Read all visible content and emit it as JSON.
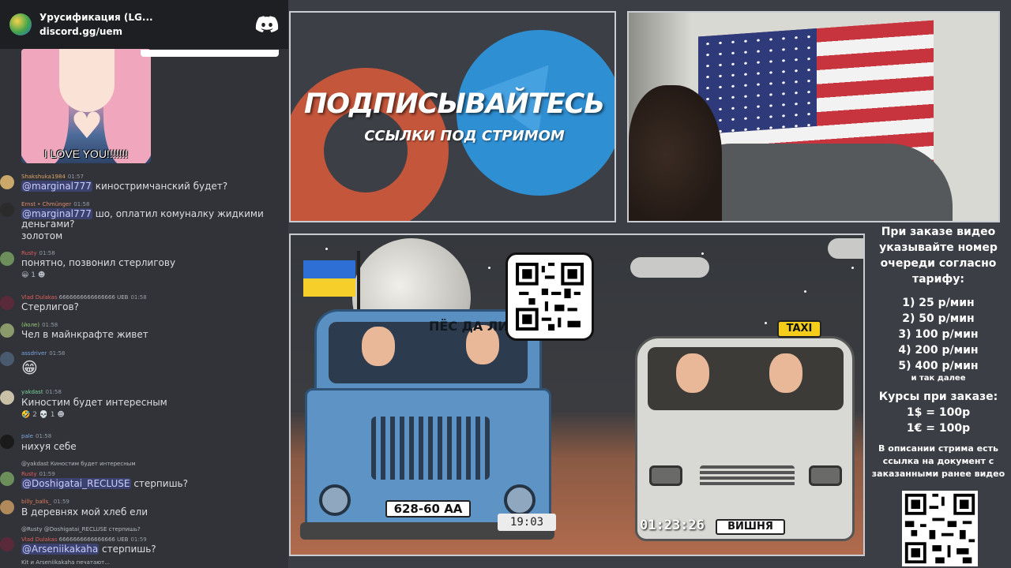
{
  "server": {
    "name": "Урусификация (LG...",
    "invite": "discord.gg/uem"
  },
  "gif": {
    "caption": "I LOVE YOU!!!!!!!"
  },
  "messages": [
    {
      "author": "Shakshuka1984",
      "author_color": "#d9a466",
      "time": "01:57",
      "mention": "@marginal777",
      "text": " киностримчанский будет?"
    },
    {
      "author": "Ernst • Chmünger",
      "author_color": "#e08a6c",
      "time": "01:58",
      "mention": "@marginal777",
      "text": " шо, оплатил комуналку жидкими деньгами?",
      "extra": "золотом"
    },
    {
      "author": "Rusty",
      "author_color": "#e05d5d",
      "time": "01:58",
      "text": "понятно, позвонил стерлигову",
      "reactions": "1"
    },
    {
      "author": "Vlad Dulakas",
      "author_color": "#e05d5d",
      "badge": "6666666666666666 UEB",
      "time": "01:58",
      "text": "Стерлигов?"
    },
    {
      "author": "(йоле)",
      "author_color": "#9acd7a",
      "time": "01:58",
      "text": "Чел в майнкрафте живет"
    },
    {
      "author": "assdriver",
      "author_color": "#7aa6e0",
      "time": "01:58",
      "emoji": "😁"
    },
    {
      "author": "yakdast",
      "author_color": "#7ad49a",
      "time": "01:58",
      "text": "Киностим будет интересным",
      "reactions_a": "2",
      "reactions_b": "1"
    },
    {
      "author": "pale",
      "author_color": "#7aa6e0",
      "time": "01:58",
      "text": "нихуя себе"
    },
    {
      "reply": "@yakdast Киностим будет интересным",
      "author": "Rusty",
      "author_color": "#e05d5d",
      "time": "01:59",
      "mention": "@Doshigatai_RECLUSE",
      "text": " стерпишь?"
    },
    {
      "author": "billy_balls_",
      "author_color": "#e07a5a",
      "time": "01:59",
      "text": "В деревнях мой хлеб ели"
    },
    {
      "reply": "@Rusty @Doshigatai_RECLUSE стерпишь?",
      "author": "Vlad Dulakas",
      "author_color": "#e05d5d",
      "badge": "6666666666666666 UEB",
      "time": "01:59",
      "mention": "@Arseniikakaha",
      "text": " стерпишь?"
    }
  ],
  "typing": "Kit и Arseniikakaha печатают...",
  "promo": {
    "title": "ПОДПИСЫВАЙТЕСЬ",
    "subtitle": "ССЫЛКИ ПОД СТРИМОМ"
  },
  "video": {
    "truck_name": "ПЁС ДА ЛИС",
    "truck_plate": "628-60 AA",
    "timer_left": "19:03",
    "taxi_sign": "TAXI",
    "van_plate": "ВИШНЯ",
    "timer_right": "01:23:26"
  },
  "price": {
    "header": "При заказе видео указывайте номер очереди согласно тарифу:",
    "tiers": [
      "1) 25 р/мин",
      "2) 50 р/мин",
      "3) 100 р/мин",
      "4) 200 р/мин",
      "5) 400 р/мин"
    ],
    "tier_note": "и так далее",
    "rates_title": "Курсы при заказе:",
    "rates": [
      "1$ = 100р",
      "1€ = 100р"
    ],
    "desc_note": "В описании стрима есть ссылка на документ с заказанными ранее видео"
  }
}
